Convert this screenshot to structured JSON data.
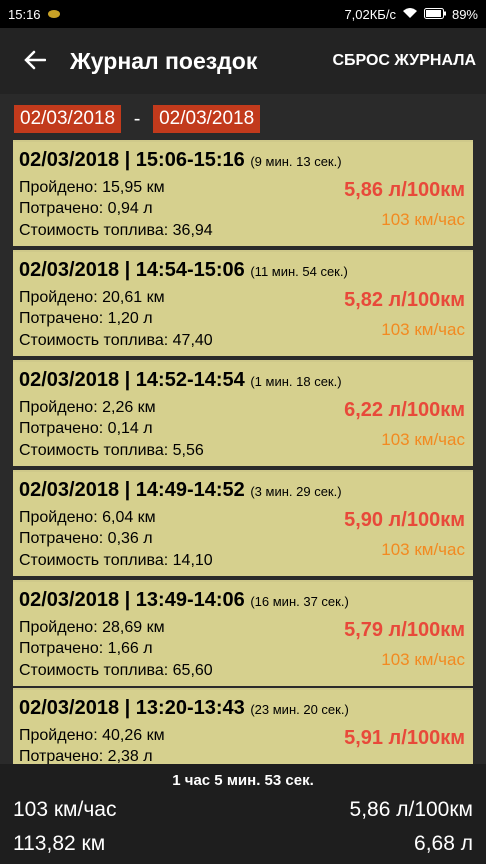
{
  "status": {
    "time": "15:16",
    "network_speed": "7,02КБ/с",
    "battery": "89%"
  },
  "header": {
    "title": "Журнал поездок",
    "reset_label": "СБРОС ЖУРНАЛА"
  },
  "date_range": {
    "from": "02/03/2018",
    "separator": "-",
    "to": "02/03/2018"
  },
  "trips": [
    {
      "header": "02/03/2018 | 15:06-15:16",
      "duration": "(9 мин. 13 сек.)",
      "distance": "Пройдено: 15,95 км",
      "spent": "Потрачено: 0,94 л",
      "cost": "Стоимость топлива: 36,94",
      "consumption": "5,86 л/100км",
      "speed": "103 км/час"
    },
    {
      "header": "02/03/2018 | 14:54-15:06",
      "duration": "(11 мин. 54 сек.)",
      "distance": "Пройдено: 20,61 км",
      "spent": "Потрачено: 1,20 л",
      "cost": "Стоимость топлива: 47,40",
      "consumption": "5,82 л/100км",
      "speed": "103 км/час"
    },
    {
      "header": "02/03/2018 | 14:52-14:54",
      "duration": "(1 мин. 18 сек.)",
      "distance": "Пройдено: 2,26 км",
      "spent": "Потрачено: 0,14 л",
      "cost": "Стоимость топлива: 5,56",
      "consumption": "6,22 л/100км",
      "speed": "103 км/час"
    },
    {
      "header": "02/03/2018 | 14:49-14:52",
      "duration": "(3 мин. 29 сек.)",
      "distance": "Пройдено: 6,04 км",
      "spent": "Потрачено: 0,36 л",
      "cost": "Стоимость топлива: 14,10",
      "consumption": "5,90 л/100км",
      "speed": "103 км/час"
    },
    {
      "header": "02/03/2018 | 13:49-14:06",
      "duration": "(16 мин. 37 сек.)",
      "distance": "Пройдено: 28,69 км",
      "spent": "Потрачено: 1,66 л",
      "cost": "Стоимость топлива: 65,60",
      "consumption": "5,79 л/100км",
      "speed": "103 км/час"
    },
    {
      "header": "02/03/2018 | 13:20-13:43",
      "duration": "(23 мин. 20 сек.)",
      "distance": "Пройдено: 40,26 км",
      "spent": "Потрачено: 2,38 л",
      "cost": "",
      "consumption": "5,91 л/100км",
      "speed": ""
    }
  ],
  "footer": {
    "total_duration": "1 час 5 мин. 53 сек.",
    "avg_speed": "103 км/час",
    "total_distance": "113,82 км",
    "avg_consumption": "5,86 л/100км",
    "total_fuel": "6,68 л"
  },
  "colors": {
    "date_box": "#c23a1c",
    "card_bg": "#d6d08e",
    "consumption": "#e8493a",
    "speed": "#f28a21"
  }
}
